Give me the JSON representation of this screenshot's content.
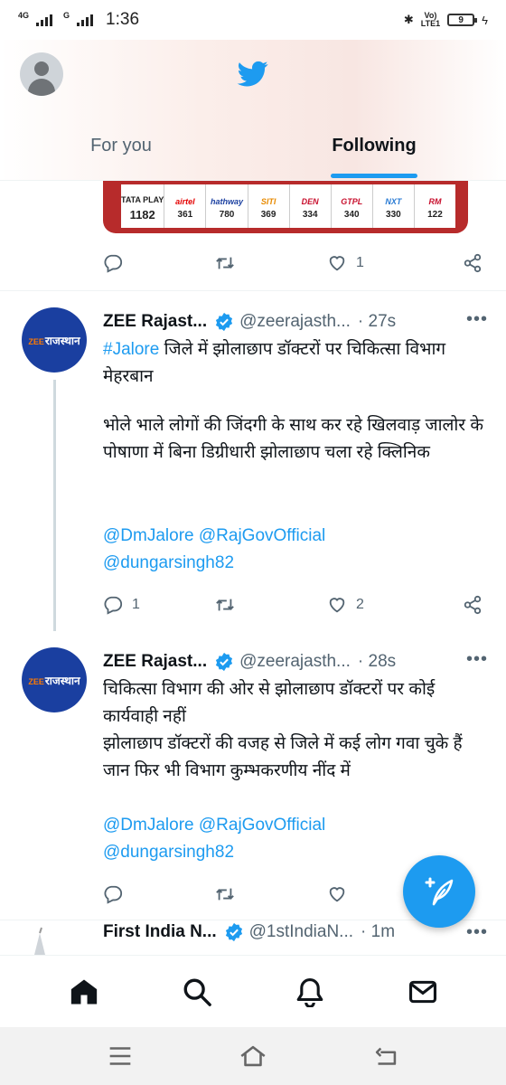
{
  "status_bar": {
    "network_1": "4G",
    "network_2": "G",
    "time": "1:36",
    "lte": "Vo)\nLTE1",
    "battery": "9"
  },
  "header": {
    "logo_icon": "twitter-bird-icon",
    "tabs": [
      {
        "label": "For you",
        "active": false
      },
      {
        "label": "Following",
        "active": true
      }
    ]
  },
  "partial_tweet": {
    "channels": [
      {
        "logo": "TATA PLAY",
        "number": "1182",
        "color": "#222222"
      },
      {
        "logo": "airtel",
        "number": "361",
        "color": "#e40000"
      },
      {
        "logo": "hathway",
        "number": "780",
        "color": "#1a3fa0"
      },
      {
        "logo": "SITI",
        "number": "369",
        "color": "#e88a00"
      },
      {
        "logo": "DEN",
        "number": "334",
        "color": "#c8102e"
      },
      {
        "logo": "GTPL",
        "number": "340",
        "color": "#c8102e"
      },
      {
        "logo": "NXT",
        "number": "330",
        "color": "#2a7bd4"
      },
      {
        "logo": "RM",
        "number": "122",
        "color": "#c8102e"
      }
    ],
    "actions": {
      "replies": "",
      "retweets": "",
      "likes": "1"
    }
  },
  "tweets": [
    {
      "avatar_text": "राजस्थान",
      "avatar_prefix": "ZEE",
      "name": "ZEE Rajast...",
      "handle": "@zeerajasth...",
      "time": "· 27s",
      "hashtag": "#Jalore",
      "text_1": " जिले में झोलाछाप डॉक्टरों पर चिकित्सा विभाग मेहरबान",
      "text_2": "भोले भाले लोगों की जिंदगी के साथ कर रहे खिलवाड़ जालोर के पोषाणा में बिना डिग्रीधारी झोलाछाप चला रहे क्लिनिक",
      "mentions_1": "@DmJalore @RajGovOfficial",
      "mentions_2": "@dungarsingh82",
      "actions": {
        "replies": "1",
        "retweets": "",
        "likes": "2"
      }
    },
    {
      "avatar_text": "राजस्थान",
      "avatar_prefix": "ZEE",
      "name": "ZEE Rajast...",
      "handle": "@zeerajasth...",
      "time": "· 28s",
      "text_1": "चिकित्सा विभाग की ओर से झोलाछाप डॉक्टरों पर कोई कार्यवाही नहीं",
      "text_2": "झोलाछाप डॉक्टरों की वजह से जिले में कई लोग गवा चुके हैं जान फिर भी विभाग कुम्भकरणीय नींद में",
      "mentions_1": "@DmJalore @RajGovOfficial",
      "mentions_2": "@dungarsingh82",
      "actions": {
        "replies": "",
        "retweets": "",
        "likes": ""
      }
    },
    {
      "name": "First India N...",
      "handle": "@1stIndiaN...",
      "time": "· 1m"
    }
  ],
  "fab": {
    "icon": "compose-tweet-icon"
  },
  "bottom_nav": [
    "home-icon",
    "search-icon",
    "notifications-icon",
    "messages-icon"
  ],
  "system_nav": [
    "menu-icon",
    "home-icon",
    "back-icon"
  ],
  "colors": {
    "accent": "#1d9bf0",
    "text": "#0f1419",
    "muted": "#536471",
    "avatar_bg": "#1a3fa0"
  }
}
